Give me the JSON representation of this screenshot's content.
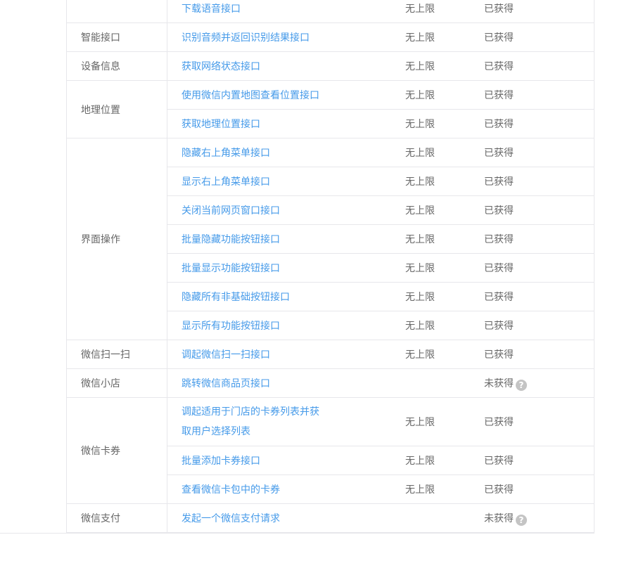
{
  "groups": [
    {
      "category": "",
      "items": [
        {
          "name": "下载语音接口",
          "limit": "无上限",
          "status": "已获得"
        }
      ]
    },
    {
      "category": "智能接口",
      "items": [
        {
          "name": "识别音频并返回识别结果接口",
          "limit": "无上限",
          "status": "已获得"
        }
      ]
    },
    {
      "category": "设备信息",
      "items": [
        {
          "name": "获取网络状态接口",
          "limit": "无上限",
          "status": "已获得"
        }
      ]
    },
    {
      "category": "地理位置",
      "items": [
        {
          "name": "使用微信内置地图查看位置接口",
          "limit": "无上限",
          "status": "已获得"
        },
        {
          "name": "获取地理位置接口",
          "limit": "无上限",
          "status": "已获得"
        }
      ]
    },
    {
      "category": "界面操作",
      "items": [
        {
          "name": "隐藏右上角菜单接口",
          "limit": "无上限",
          "status": "已获得"
        },
        {
          "name": "显示右上角菜单接口",
          "limit": "无上限",
          "status": "已获得"
        },
        {
          "name": "关闭当前网页窗口接口",
          "limit": "无上限",
          "status": "已获得"
        },
        {
          "name": "批量隐藏功能按钮接口",
          "limit": "无上限",
          "status": "已获得"
        },
        {
          "name": "批量显示功能按钮接口",
          "limit": "无上限",
          "status": "已获得"
        },
        {
          "name": "隐藏所有非基础按钮接口",
          "limit": "无上限",
          "status": "已获得"
        },
        {
          "name": "显示所有功能按钮接口",
          "limit": "无上限",
          "status": "已获得"
        }
      ]
    },
    {
      "category": "微信扫一扫",
      "items": [
        {
          "name": "调起微信扫一扫接口",
          "limit": "无上限",
          "status": "已获得"
        }
      ]
    },
    {
      "category": "微信小店",
      "items": [
        {
          "name": "跳转微信商品页接口",
          "limit": "",
          "status": "未获得",
          "help": "?"
        }
      ]
    },
    {
      "category": "微信卡券",
      "items": [
        {
          "name": "调起适用于门店的卡券列表并获取用户选择列表",
          "limit": "无上限",
          "status": "已获得",
          "tall": true
        },
        {
          "name": "批量添加卡券接口",
          "limit": "无上限",
          "status": "已获得"
        },
        {
          "name": "查看微信卡包中的卡券",
          "limit": "无上限",
          "status": "已获得"
        }
      ]
    },
    {
      "category": "微信支付",
      "items": [
        {
          "name": "发起一个微信支付请求",
          "limit": "",
          "status": "未获得",
          "help": "?"
        }
      ]
    }
  ]
}
